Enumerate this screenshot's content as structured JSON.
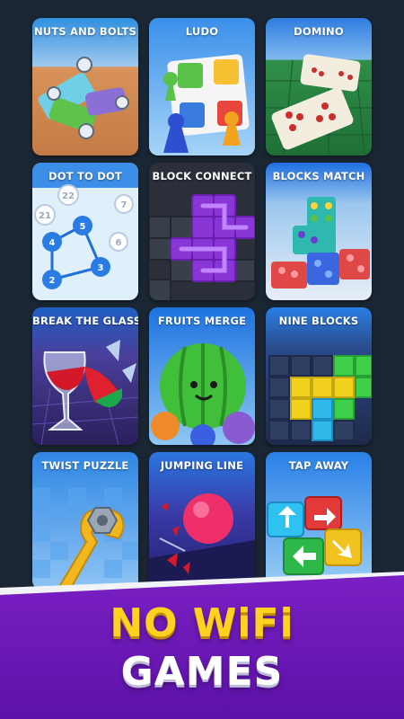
{
  "games": [
    {
      "label": "NUTS AND BOLTS"
    },
    {
      "label": "LUDO"
    },
    {
      "label": "DOMINO"
    },
    {
      "label": "DOT TO DOT"
    },
    {
      "label": "BLOCK CONNECT"
    },
    {
      "label": "BLOCKS MATCH"
    },
    {
      "label": "BREAK THE GLASS"
    },
    {
      "label": "FRUITS MERGE"
    },
    {
      "label": "NINE BLOCKS"
    },
    {
      "label": "TWIST PUZZLE"
    },
    {
      "label": "JUMPING LINE"
    },
    {
      "label": "TAP AWAY"
    }
  ],
  "dot_numbers": [
    "22",
    "7",
    "21",
    "5",
    "6",
    "4",
    "3",
    "2"
  ],
  "headline": {
    "line1": "NO WiFi",
    "line2": "GAMES"
  },
  "colors": {
    "background": "#1a2633",
    "banner": "#6a18b8",
    "headline_yellow": "#ffd21f"
  }
}
